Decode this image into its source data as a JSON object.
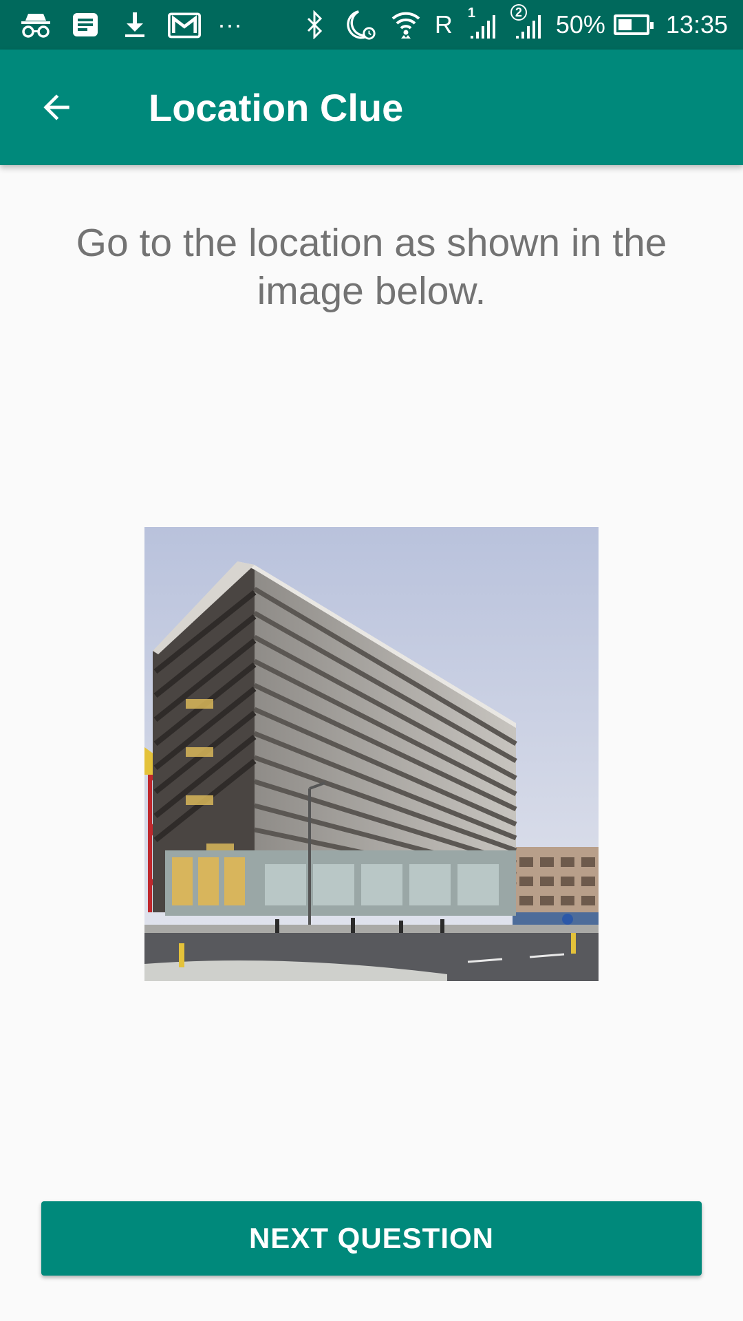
{
  "status_bar": {
    "more": "···",
    "network_type": "R",
    "sim1": "1",
    "sim2": "2",
    "battery_percent": "50%",
    "battery_level": 0.5,
    "time": "13:35",
    "icons": [
      "incognito-icon",
      "news-icon",
      "download-icon",
      "gmail-icon",
      "more-notifications-icon",
      "bluetooth-icon",
      "do-not-disturb-alarm-icon",
      "wifi-icon",
      "signal-sim1-icon",
      "signal-sim2-icon",
      "battery-icon"
    ]
  },
  "app_bar": {
    "back_icon": "arrow-back-icon",
    "title": "Location Clue"
  },
  "main": {
    "instruction": "Go to the location as shown in the image below.",
    "image_description_icon": "location-photo"
  },
  "actions": {
    "next_label": "NEXT QUESTION"
  },
  "colors": {
    "status_bar": "#00695c",
    "primary": "#00897b",
    "background": "#fafafa",
    "instruction_text": "#737373"
  }
}
